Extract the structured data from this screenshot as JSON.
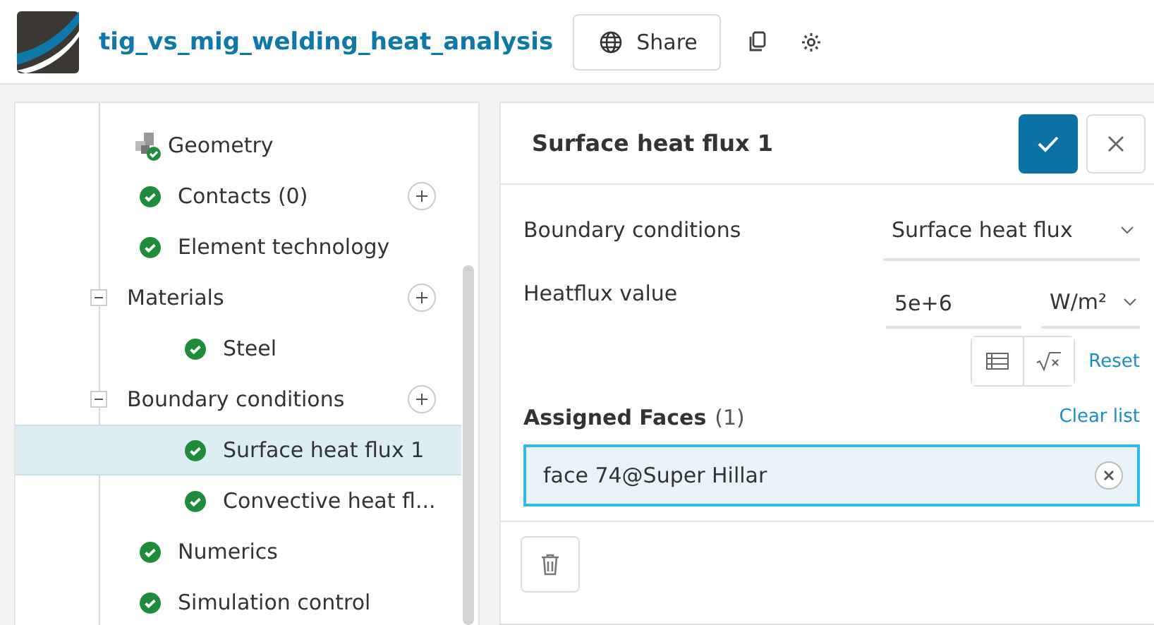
{
  "header": {
    "project_title": "tig_vs_mig_welding_heat_analysis",
    "share_button": "Share"
  },
  "tree": [
    {
      "label": "Geometry",
      "kind": "geometry",
      "selected": false,
      "add_button": false
    },
    {
      "label": "Contacts (0)",
      "kind": "check",
      "selected": false,
      "add_button": true
    },
    {
      "label": "Element technology",
      "kind": "check",
      "selected": false,
      "add_button": false
    },
    {
      "label": "Materials",
      "kind": "folder",
      "selected": false,
      "add_button": true,
      "expanded": true,
      "children": [
        {
          "label": "Steel",
          "kind": "check",
          "selected": false,
          "add_button": false
        }
      ]
    },
    {
      "label": "Boundary conditions",
      "kind": "folder",
      "selected": false,
      "add_button": true,
      "expanded": true,
      "children": [
        {
          "label": "Surface heat flux 1",
          "kind": "check",
          "selected": true,
          "add_button": false
        },
        {
          "label": "Convective heat fl...",
          "kind": "check",
          "selected": false,
          "add_button": false
        }
      ]
    },
    {
      "label": "Numerics",
      "kind": "check",
      "selected": false,
      "add_button": false
    },
    {
      "label": "Simulation control",
      "kind": "check",
      "selected": false,
      "add_button": false
    }
  ],
  "panel": {
    "title": "Surface heat flux 1",
    "boundary_conditions": {
      "label": "Boundary conditions",
      "value": "Surface heat flux"
    },
    "heatflux": {
      "label": "Heatflux value",
      "value": "5e+6",
      "unit": "W/m²",
      "reset_link": "Reset"
    },
    "assigned_faces": {
      "label": "Assigned Faces",
      "count": "(1)",
      "clear_link": "Clear list",
      "items": [
        "face 74@Super Hillar"
      ]
    }
  }
}
